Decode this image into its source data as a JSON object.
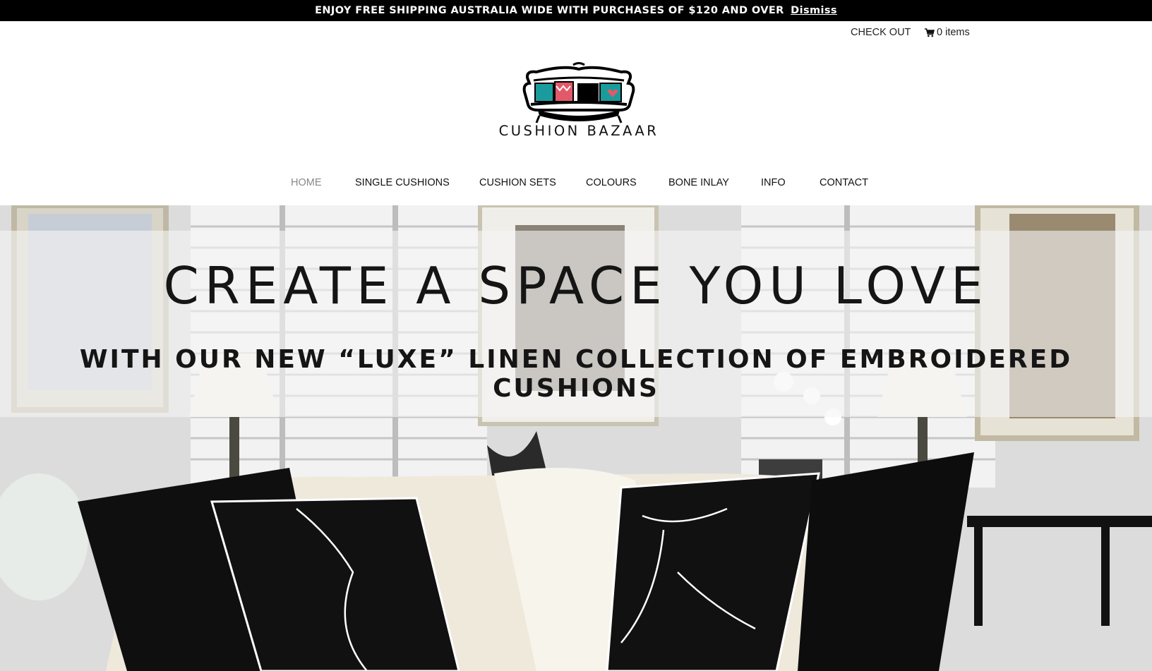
{
  "promo": {
    "message": "ENJOY FREE SHIPPING AUSTRALIA WIDE WITH PURCHASES OF $120 AND OVER",
    "dismiss": "Dismiss"
  },
  "header": {
    "checkout": "CHECK OUT",
    "cart_icon": "cart-icon",
    "cart": "0 items",
    "brand": "CUSHION BAZAAR"
  },
  "nav": {
    "items": [
      {
        "label": "HOME",
        "active": true
      },
      {
        "label": "SINGLE CUSHIONS",
        "active": false
      },
      {
        "label": "CUSHION SETS",
        "active": false
      },
      {
        "label": "COLOURS",
        "active": false
      },
      {
        "label": "BONE INLAY",
        "active": false
      },
      {
        "label": "INFO",
        "active": false
      },
      {
        "label": "CONTACT",
        "active": false
      }
    ]
  },
  "hero": {
    "headline": "CREATE A SPACE YOU LOVE",
    "subline": "WITH OUR NEW “LUXE” LINEN COLLECTION OF EMBROIDERED CUSHIONS"
  },
  "colors": {
    "promo_bg": "#000000",
    "text": "#111111",
    "nav_active": "#888888"
  }
}
